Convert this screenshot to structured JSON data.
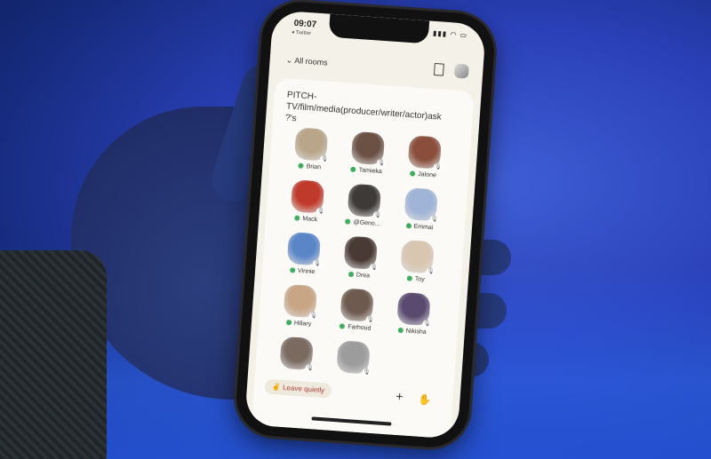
{
  "status": {
    "time": "09:07",
    "back": "◂ Twitter"
  },
  "nav": {
    "all_rooms": "All rooms"
  },
  "room": {
    "title": "PITCH- TV/film/media(producer/writer/actor)ask ?'s"
  },
  "speakers": [
    {
      "name": "Brian",
      "color": "#b9a58a"
    },
    {
      "name": "Tamieka",
      "color": "#6b5044"
    },
    {
      "name": "Jalone",
      "color": "#8a4f3c"
    },
    {
      "name": "Mack",
      "color": "#c03a2b"
    },
    {
      "name": "@Geno...",
      "color": "#3e3a38"
    },
    {
      "name": "Emmai",
      "color": "#9fb4d6"
    },
    {
      "name": "Vinnie",
      "color": "#5a86c8"
    },
    {
      "name": "Drea",
      "color": "#4a3a36"
    },
    {
      "name": "Toy",
      "color": "#d8c6b0"
    },
    {
      "name": "Hillary",
      "color": "#c7a585"
    },
    {
      "name": "Farhoud",
      "color": "#6e5a4e"
    },
    {
      "name": "Nikisha",
      "color": "#5a4a70"
    },
    {
      "name": "",
      "color": "#7a6a60"
    },
    {
      "name": "",
      "color": "#9c9c9c"
    }
  ],
  "footer": {
    "leave": "✌ Leave quietly",
    "plus": "+",
    "raise": "✋"
  }
}
